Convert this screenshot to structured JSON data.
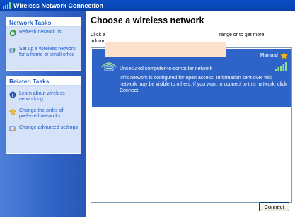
{
  "window": {
    "title": "Wireless Network Connection"
  },
  "sidebar": {
    "network_tasks": {
      "header": "Network Tasks",
      "items": [
        {
          "label": "Refresh network list",
          "icon": "refresh-icon"
        },
        {
          "label": "Set up a wireless network for a home or small office",
          "icon": "setup-network-icon"
        }
      ]
    },
    "related_tasks": {
      "header": "Related Tasks",
      "items": [
        {
          "label": "Learn about wireless networking",
          "icon": "info-icon"
        },
        {
          "label": "Change the order of preferred networks",
          "icon": "star-icon"
        },
        {
          "label": "Change advanced settings",
          "icon": "settings-icon"
        }
      ]
    }
  },
  "main": {
    "title": "Choose a wireless network",
    "hint_start": "Click a",
    "hint_end": "range or to get more",
    "hint_line2": "inform",
    "networks": [
      {
        "name": "",
        "mode": "Manual",
        "security": "Unsecured computer-to-computer network",
        "description": "This network is configured for open access. Information sent over this network may be visible to others. If you want to connect to this network, click Connect.",
        "selected": true
      }
    ],
    "connect_label": "Connect"
  },
  "colors": {
    "title_bar": "#0847b7",
    "sidebar": "#2e60c4",
    "selection": "#2e64c8",
    "link": "#215dc6"
  }
}
